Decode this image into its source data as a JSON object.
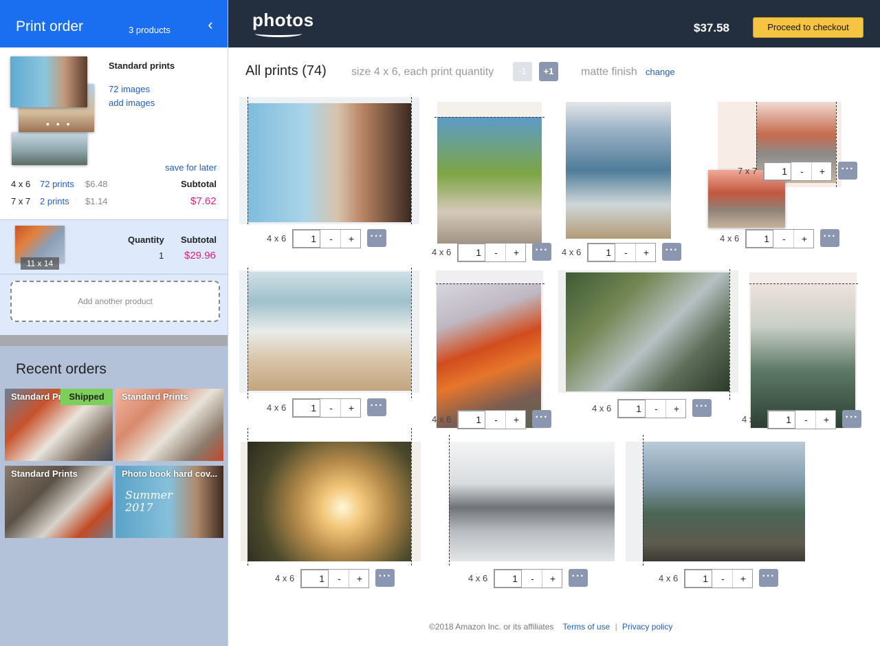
{
  "sidebar": {
    "header": {
      "title": "Print order",
      "product_count": "3 products",
      "back_icon": "chevron-left-icon"
    },
    "order1": {
      "product_name": "Standard prints",
      "image_count": "72 images",
      "add_images": "add images",
      "save_for_later": "save for later",
      "dots": "• • •",
      "rows": [
        {
          "size": "4 x 6",
          "count": "72 prints",
          "price": "$6.48"
        },
        {
          "size": "7 x 7",
          "count": "2 prints",
          "price": "$1.14"
        }
      ],
      "subtotal_label": "Subtotal",
      "subtotal_value": "$7.62"
    },
    "order2": {
      "size_badge": "11 x 14",
      "quantity_label": "Quantity",
      "quantity_value": "1",
      "subtotal_label": "Subtotal",
      "subtotal_value": "$29.96"
    },
    "add_product": "Add another product",
    "recent": {
      "title": "Recent orders",
      "tiles": [
        {
          "label": "Standard Prints",
          "badge": "Shipped"
        },
        {
          "label": "Standard Prints"
        },
        {
          "label": "Standard Prints"
        },
        {
          "label": "Photo book hard cov...",
          "script_text": "Summer 2017"
        }
      ]
    }
  },
  "topbar": {
    "logo": "photos",
    "price": "$37.58",
    "checkout": "Proceed to checkout"
  },
  "summary": {
    "title": "All prints (74)",
    "spec": "size 4 x 6,  each print quantity",
    "minus": "-1",
    "plus": "+1",
    "finish": "matte finish",
    "change": "change"
  },
  "prints": [
    {
      "size": "4 x 6",
      "qty": "1"
    },
    {
      "size": "4 x 6",
      "qty": "1"
    },
    {
      "size": "4 x 6",
      "qty": "1"
    },
    {
      "size": "4 x 6",
      "qty": "1",
      "overlay_size": "7 x 7",
      "overlay_qty": "1"
    },
    {
      "size": "4 x 6",
      "qty": "1"
    },
    {
      "size": "4 x 6",
      "qty": "1"
    },
    {
      "size": "4 x 6",
      "qty": "1"
    },
    {
      "size": "4 x 6",
      "qty": "1"
    },
    {
      "size": "4 x 6",
      "qty": "1"
    },
    {
      "size": "4 x 6",
      "qty": "1"
    },
    {
      "size": "4 x 6",
      "qty": "1"
    }
  ],
  "controls": {
    "minus": "-",
    "plus": "+",
    "more": "···"
  },
  "footer": {
    "copyright": "©2018 Amazon Inc. or its affiliates",
    "terms": "Terms of use",
    "separator": "|",
    "privacy": "Privacy policy"
  }
}
